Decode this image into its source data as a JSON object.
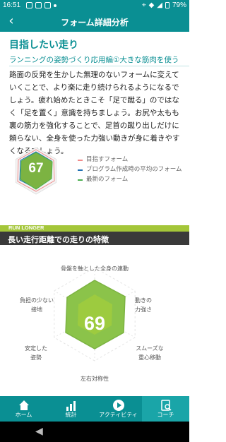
{
  "status": {
    "time": "16:51",
    "battery": "79%"
  },
  "appbar": {
    "back": "‹",
    "title": "フォーム詳細分析"
  },
  "section": {
    "title": "目指したい走り",
    "subtitle": "ランニングの姿勢づくり応用編①大きな筋肉を使う",
    "body": "路面の反発を生かした無理のないフォームに変えていくことで、より楽に走り続けられるようになるでしょう。疲れ始めたときこそ「足で蹴る」のではなく「足を置く」意識を持ちましょう。お尻や太もも裏の筋力を強化することで、足首の蹴り出しだけに頼らない、全身を使った力強い動きが身に着きやすくなるでしょう。"
  },
  "radar_small": {
    "score": "67",
    "legend": [
      {
        "label": "目指すフォーム",
        "color": "#f08a8a"
      },
      {
        "label": "プログラム作成時の平均のフォーム",
        "color": "#1f6fb2"
      },
      {
        "label": "最新のフォーム",
        "color": "#4caf50"
      }
    ]
  },
  "band": {
    "label": "RUN LONGER"
  },
  "long_run": {
    "title": "長い走行距離での走りの特徴",
    "score": "69",
    "axes": {
      "top": "骨盤を軸とした全身の連動",
      "right_upper": "動きの\n力強さ",
      "right_lower": "スムーズな\n重心移動",
      "bottom": "左右対称性",
      "left_lower": "安定した\n姿勢",
      "left_upper": "負担の少ない\n接地"
    },
    "colors": {
      "accent": "#8bc34a",
      "dark": "#5a8f12"
    }
  },
  "tabs": [
    {
      "label": "ホーム",
      "icon": "home-icon"
    },
    {
      "label": "統計",
      "icon": "stats-icon"
    },
    {
      "label": "アクティビティ",
      "icon": "play-icon"
    },
    {
      "label": "コーチ",
      "icon": "coach-icon",
      "active": true
    }
  ],
  "nav": {
    "back": "◀"
  }
}
